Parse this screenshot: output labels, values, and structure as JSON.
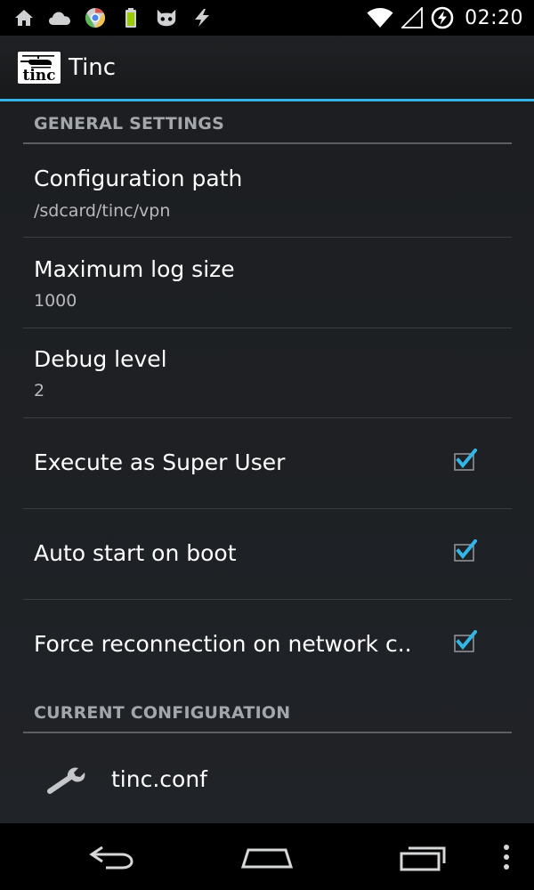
{
  "status_bar": {
    "time": "02:20",
    "left_icons": [
      "home-icon",
      "cloud-icon",
      "chrome-icon",
      "battery-app-icon",
      "cyanogen-icon",
      "flash-icon"
    ],
    "right_icons": [
      "wifi-icon",
      "signal-icon",
      "battery-charging-icon"
    ]
  },
  "action_bar": {
    "logo_text": "tinc",
    "title": "Tinc",
    "accent_color": "#33b5e5"
  },
  "general": {
    "header": "GENERAL SETTINGS",
    "items": [
      {
        "title": "Configuration path",
        "summary": "/sdcard/tinc/vpn"
      },
      {
        "title": "Maximum log size",
        "summary": "1000"
      },
      {
        "title": "Debug level",
        "summary": "2"
      },
      {
        "title": "Execute as Super User",
        "checked": true
      },
      {
        "title": "Auto start on boot",
        "checked": true
      },
      {
        "title": "Force reconnection on network c..",
        "checked": true
      }
    ]
  },
  "current": {
    "header": "CURRENT CONFIGURATION",
    "files": [
      {
        "label": "tinc.conf",
        "icon": "wrench-icon"
      }
    ]
  },
  "nav_bar": {
    "buttons": [
      "back-icon",
      "home-icon",
      "recent-apps-icon",
      "overflow-menu-icon"
    ]
  }
}
